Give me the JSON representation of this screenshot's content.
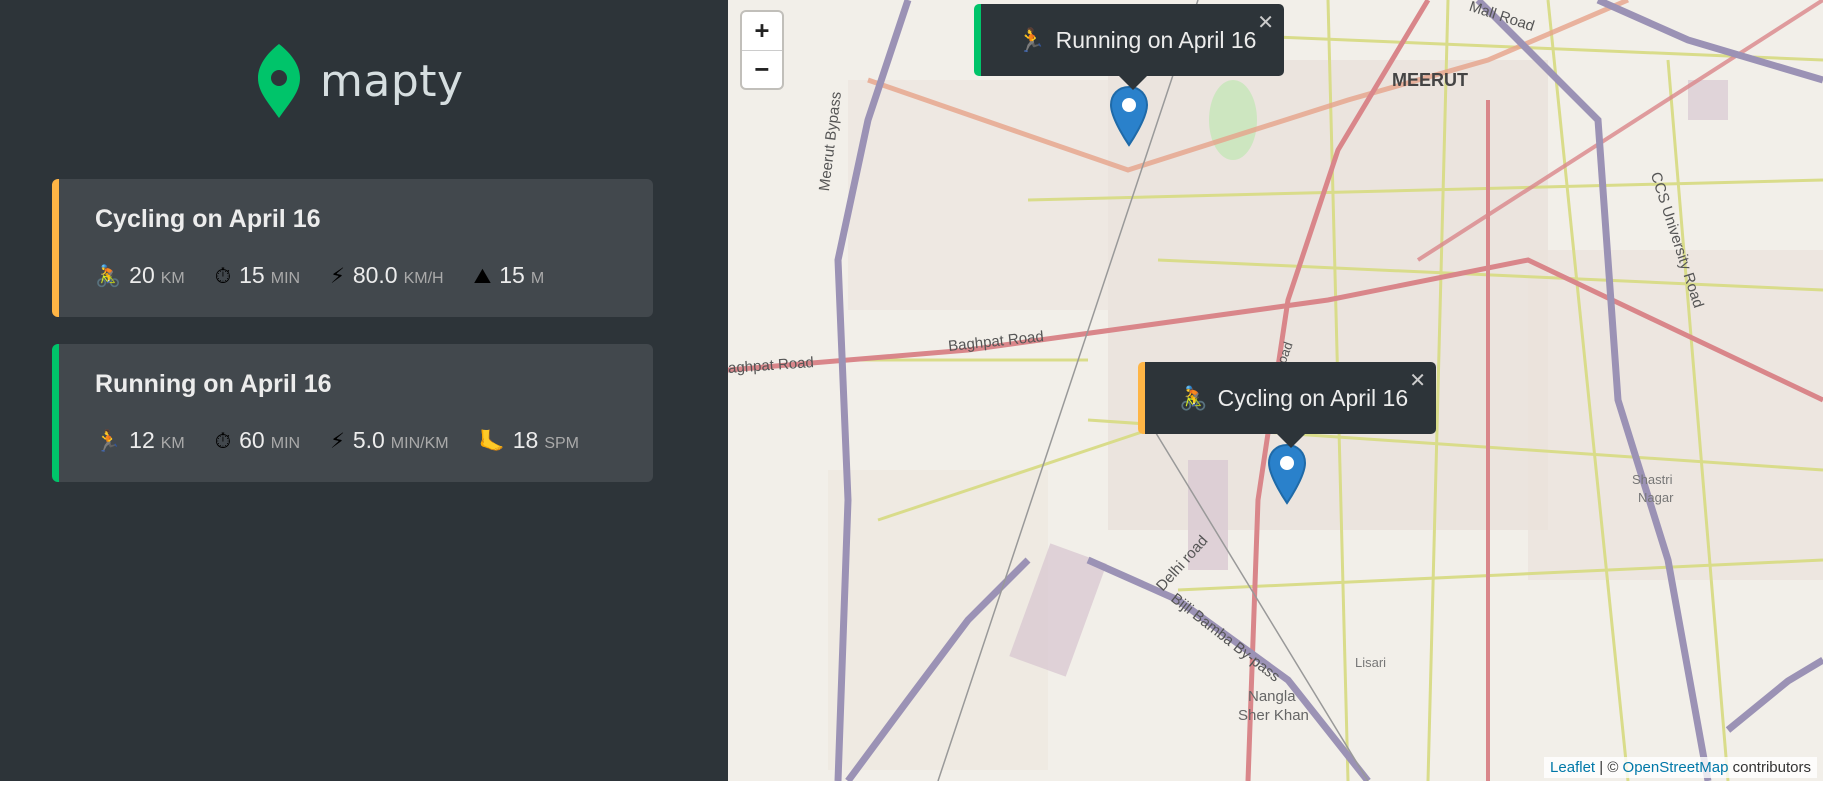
{
  "logo": {
    "text": "mapty",
    "color": "#00c46a"
  },
  "workouts": [
    {
      "type": "cycling",
      "title": "Cycling on April 16",
      "accent": "#ffb545",
      "details": [
        {
          "icon": "🚴",
          "icon_name": "cyclist-icon",
          "value": "20",
          "unit": "KM"
        },
        {
          "icon": "⏱",
          "icon_name": "stopwatch-icon",
          "value": "15",
          "unit": "MIN"
        },
        {
          "icon": "⚡",
          "icon_name": "lightning-icon",
          "value": "80.0",
          "unit": "KM/H"
        },
        {
          "icon": "⛰",
          "icon_name": "mountain-icon",
          "value": "15",
          "unit": "M"
        }
      ]
    },
    {
      "type": "running",
      "title": "Running on April 16",
      "accent": "#00c46a",
      "details": [
        {
          "icon": "🏃",
          "icon_name": "runner-icon",
          "value": "12",
          "unit": "KM"
        },
        {
          "icon": "⏱",
          "icon_name": "stopwatch-icon",
          "value": "60",
          "unit": "MIN"
        },
        {
          "icon": "⚡",
          "icon_name": "lightning-icon",
          "value": "5.0",
          "unit": "MIN/KM"
        },
        {
          "icon": "🦶",
          "icon_name": "foot-icon",
          "value": "18",
          "unit": "SPM"
        }
      ]
    }
  ],
  "map": {
    "zoom_in": "+",
    "zoom_out": "−",
    "popups": [
      {
        "type": "running",
        "icon": "🏃",
        "text": "Running on April 16",
        "close": "✕"
      },
      {
        "type": "cycling",
        "icon": "🚴",
        "text": "Cycling on April 16",
        "close": "✕"
      }
    ],
    "labels": {
      "meerut": "MEERUT",
      "mall_road": "Mall Road",
      "meerut_bypass": "Meerut Bypass",
      "baghpat_road": "Baghpat Road",
      "baghpat_road_left": "aghpat Road",
      "ccs_university_road": "CCS University Road",
      "delhi_road": "Delhi road",
      "bijli_bamba": "Bijli Bamba By-pass",
      "shastri_nagar_1": "Shastri",
      "shastri_nagar_2": "Nagar",
      "lisari": "Lisari",
      "nangla_1": "Nangla",
      "nangla_2": "Sher Khan",
      "road_fragment": "oad"
    },
    "attribution": {
      "leaflet": "Leaflet",
      "separator": " | © ",
      "osm": "OpenStreetMap",
      "suffix": " contributors"
    }
  }
}
